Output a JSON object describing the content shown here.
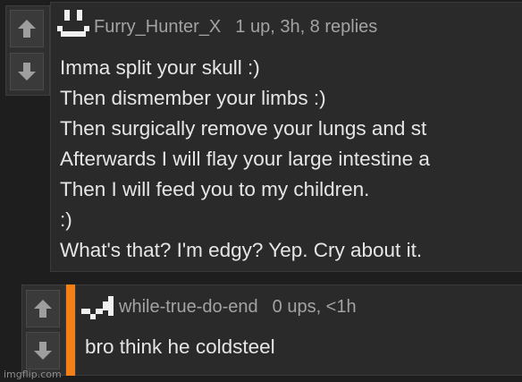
{
  "comment1": {
    "username": "Furry_Hunter_X",
    "stats": "1 up, 3h, 8 replies",
    "lines": [
      "Imma split your skull :)",
      "Then dismember your limbs :)",
      "Then surgically remove your lungs and st",
      "Afterwards I will flay your large intestine a",
      "Then I will feed you to my children.",
      ":)",
      "What's that? I'm edgy? Yep. Cry about it."
    ]
  },
  "comment2": {
    "username": "while-true-do-end",
    "stats": "0 ups, <1h",
    "lines": [
      "bro think he coldsteel"
    ]
  },
  "watermark": "imgflip.com",
  "colors": {
    "background": "#1e1e1e",
    "panel": "#2a2a2a",
    "meta_text": "#a3a3a3",
    "body_text": "#e6e6e6",
    "reply_accent": "#f57f17",
    "arrow": "#9e9e9e"
  },
  "icons": {
    "upvote": "arrow-up-icon",
    "downvote": "arrow-down-icon"
  }
}
